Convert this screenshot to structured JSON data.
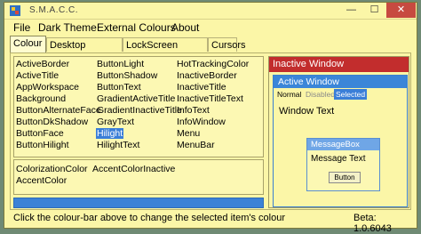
{
  "window": {
    "title": "S.M.A.C.C."
  },
  "titlebar_buttons": {
    "minimize": "—",
    "maximize": "☐",
    "close": "✕"
  },
  "menu": [
    "File",
    "Dark Theme",
    "External Colours",
    "About"
  ],
  "tabs": [
    "Colour",
    "Desktop Wallpaper",
    "LockScreen Wallpaper",
    "Cursors"
  ],
  "active_tab": "Colour",
  "colour_list": {
    "col1": [
      "ActiveBorder",
      "ActiveTitle",
      "AppWorkspace",
      "Background",
      "ButtonAlternateFace",
      "ButtonDkShadow",
      "ButtonFace",
      "ButtonHilight"
    ],
    "col2": [
      "ButtonLight",
      "ButtonShadow",
      "ButtonText",
      "GradientActiveTitle",
      "GradientInactiveTitle",
      "GrayText",
      "Hilight",
      "HilightText"
    ],
    "col3": [
      "HotTrackingColor",
      "InactiveBorder",
      "InactiveTitle",
      "InactiveTitleText",
      "InfoText",
      "InfoWindow",
      "Menu",
      "MenuBar"
    ],
    "selected": "Hilight"
  },
  "extra_colours": {
    "row1": [
      "ColorizationColor",
      "AccentColorInactive"
    ],
    "row2": [
      "AccentColor"
    ]
  },
  "colour_bar": {
    "color": "#3b82d6"
  },
  "preview": {
    "inactive_title": "Inactive Window",
    "active_title": "Active Window",
    "menu_items": {
      "normal": "Normal",
      "disabled": "Disabled",
      "selected": "Selected"
    },
    "window_text": "Window Text",
    "messagebox": {
      "title": "MessageBox",
      "text": "Message Text",
      "button": "Button"
    }
  },
  "status": {
    "hint": "Click the colour-bar above to change the selected item's colour",
    "version": "Beta: 1.0.6043"
  },
  "colors": {
    "window_bg": "#fbf6a7",
    "inactive_title_bg": "#c22d2d",
    "active_title_bg": "#3b86d8",
    "highlight": "#3a7ed8",
    "close_button": "#c74a40"
  }
}
